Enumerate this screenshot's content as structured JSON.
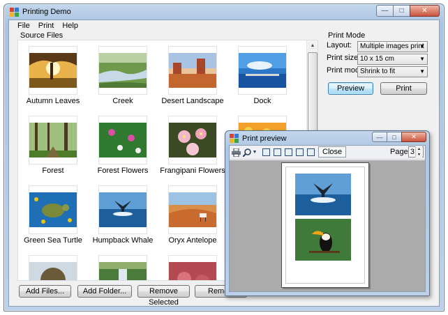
{
  "main_window": {
    "title": "Printing Demo",
    "caption_buttons": {
      "minimize": "—",
      "maximize": "□",
      "close": "✕"
    }
  },
  "menu": [
    "File",
    "Print",
    "Help"
  ],
  "source_files": {
    "label": "Source Files",
    "items": [
      {
        "caption": "Autumn Leaves",
        "icon": "autumn-leaves-photo"
      },
      {
        "caption": "Creek",
        "icon": "creek-photo"
      },
      {
        "caption": "Desert Landscape",
        "icon": "desert-landscape-photo"
      },
      {
        "caption": "Dock",
        "icon": "dock-photo"
      },
      {
        "caption": "Forest",
        "icon": "forest-photo"
      },
      {
        "caption": "Forest Flowers",
        "icon": "forest-flowers-photo"
      },
      {
        "caption": "Frangipani Flowers",
        "icon": "frangipani-flowers-photo"
      },
      {
        "caption": "",
        "icon": "partially-hidden-photo"
      },
      {
        "caption": "Green Sea Turtle",
        "icon": "green-sea-turtle-photo"
      },
      {
        "caption": "Humpback Whale",
        "icon": "humpback-whale-photo"
      },
      {
        "caption": "Oryx Antelope",
        "icon": "oryx-antelope-photo"
      },
      {
        "caption": "",
        "icon": "hidden-photo"
      }
    ]
  },
  "buttons": {
    "add_files": "Add Files...",
    "add_folder": "Add Folder...",
    "remove_selected": "Remove Selected",
    "remove_all": "Remove"
  },
  "print_mode": {
    "label": "Print Mode",
    "layout_label": "Layout:",
    "layout_value": "Multiple images print",
    "print_size_label": "Print size:",
    "print_size_value": "10 x 15 cm",
    "print_mode_label": "Print mode:",
    "print_mode_value": "Shrink to fit",
    "preview_button": "Preview",
    "print_button": "Print"
  },
  "preview_window": {
    "title": "Print preview",
    "close_button": "Close",
    "page_label": "Page",
    "page_value": "3",
    "page_images": [
      "humpback-whale-photo",
      "toucan-photo"
    ]
  }
}
